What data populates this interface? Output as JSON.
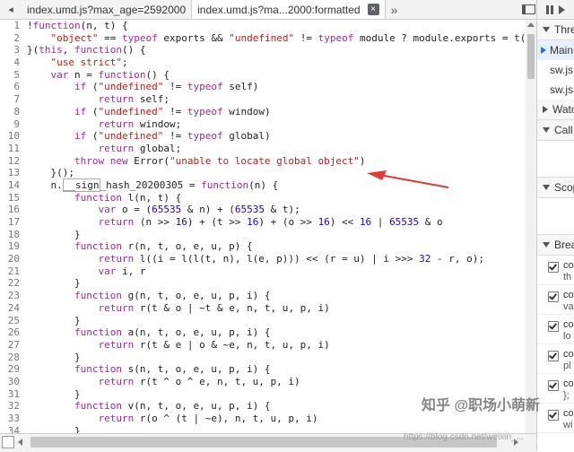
{
  "tabs": {
    "nav_left": "◂",
    "items": [
      {
        "label": "index.umd.js?max_age=2592000",
        "active": false
      },
      {
        "label": "index.umd.js?ma...2000:formatted",
        "active": true
      }
    ],
    "close_glyph": "×",
    "overflow": "»"
  },
  "code_lines": [
    {
      "n": "1",
      "parts": [
        {
          "t": "!"
        },
        {
          "t": "function",
          "c": "kw"
        },
        {
          "t": "(n, t) {"
        }
      ]
    },
    {
      "n": "2",
      "parts": [
        {
          "t": "    "
        },
        {
          "t": "\"object\"",
          "c": "str"
        },
        {
          "t": " == "
        },
        {
          "t": "typeof",
          "c": "kw"
        },
        {
          "t": " exports && "
        },
        {
          "t": "\"undefined\"",
          "c": "str"
        },
        {
          "t": " != "
        },
        {
          "t": "typeof",
          "c": "kw"
        },
        {
          "t": " module ? module.exports = t() :"
        }
      ]
    },
    {
      "n": "3",
      "parts": [
        {
          "t": "}("
        },
        {
          "t": "this",
          "c": "kw"
        },
        {
          "t": ", "
        },
        {
          "t": "function",
          "c": "kw"
        },
        {
          "t": "() {"
        }
      ]
    },
    {
      "n": "4",
      "parts": [
        {
          "t": "    "
        },
        {
          "t": "\"use strict\"",
          "c": "str"
        },
        {
          "t": ";"
        }
      ]
    },
    {
      "n": "5",
      "parts": [
        {
          "t": "    "
        },
        {
          "t": "var",
          "c": "kw"
        },
        {
          "t": " n = "
        },
        {
          "t": "function",
          "c": "kw"
        },
        {
          "t": "() {"
        }
      ]
    },
    {
      "n": "6",
      "parts": [
        {
          "t": "        "
        },
        {
          "t": "if",
          "c": "kw"
        },
        {
          "t": " ("
        },
        {
          "t": "\"undefined\"",
          "c": "str"
        },
        {
          "t": " != "
        },
        {
          "t": "typeof",
          "c": "kw"
        },
        {
          "t": " self)"
        }
      ]
    },
    {
      "n": "7",
      "parts": [
        {
          "t": "            "
        },
        {
          "t": "return",
          "c": "kw"
        },
        {
          "t": " self;"
        }
      ]
    },
    {
      "n": "8",
      "parts": [
        {
          "t": "        "
        },
        {
          "t": "if",
          "c": "kw"
        },
        {
          "t": " ("
        },
        {
          "t": "\"undefined\"",
          "c": "str"
        },
        {
          "t": " != "
        },
        {
          "t": "typeof",
          "c": "kw"
        },
        {
          "t": " window)"
        }
      ]
    },
    {
      "n": "9",
      "parts": [
        {
          "t": "            "
        },
        {
          "t": "return",
          "c": "kw"
        },
        {
          "t": " window;"
        }
      ]
    },
    {
      "n": "10",
      "parts": [
        {
          "t": "        "
        },
        {
          "t": "if",
          "c": "kw"
        },
        {
          "t": " ("
        },
        {
          "t": "\"undefined\"",
          "c": "str"
        },
        {
          "t": " != "
        },
        {
          "t": "typeof",
          "c": "kw"
        },
        {
          "t": " global)"
        }
      ]
    },
    {
      "n": "11",
      "parts": [
        {
          "t": "            "
        },
        {
          "t": "return",
          "c": "kw"
        },
        {
          "t": " global;"
        }
      ]
    },
    {
      "n": "12",
      "parts": [
        {
          "t": "        "
        },
        {
          "t": "throw new",
          "c": "kw"
        },
        {
          "t": " Error("
        },
        {
          "t": "\"unable to locate global object\"",
          "c": "str"
        },
        {
          "t": ")"
        }
      ]
    },
    {
      "n": "13",
      "parts": [
        {
          "t": "    }();"
        }
      ]
    },
    {
      "n": "14",
      "parts": [
        {
          "t": "    n."
        },
        {
          "t": "__sign",
          "c": "hl"
        },
        {
          "t": "_hash_20200305 = "
        },
        {
          "t": "function",
          "c": "kw"
        },
        {
          "t": "(n) {"
        }
      ]
    },
    {
      "n": "15",
      "parts": [
        {
          "t": "        "
        },
        {
          "t": "function",
          "c": "kw"
        },
        {
          "t": " l(n, t) {"
        }
      ]
    },
    {
      "n": "16",
      "parts": [
        {
          "t": "            "
        },
        {
          "t": "var",
          "c": "kw"
        },
        {
          "t": " o = ("
        },
        {
          "t": "65535",
          "c": "num"
        },
        {
          "t": " & n) + ("
        },
        {
          "t": "65535",
          "c": "num"
        },
        {
          "t": " & t);"
        }
      ]
    },
    {
      "n": "17",
      "parts": [
        {
          "t": "            "
        },
        {
          "t": "return",
          "c": "kw"
        },
        {
          "t": " (n >> "
        },
        {
          "t": "16",
          "c": "num"
        },
        {
          "t": ") + (t >> "
        },
        {
          "t": "16",
          "c": "num"
        },
        {
          "t": ") + (o >> "
        },
        {
          "t": "16",
          "c": "num"
        },
        {
          "t": ") << "
        },
        {
          "t": "16",
          "c": "num"
        },
        {
          "t": " | "
        },
        {
          "t": "65535",
          "c": "num"
        },
        {
          "t": " & o"
        }
      ]
    },
    {
      "n": "18",
      "parts": [
        {
          "t": "        }"
        }
      ]
    },
    {
      "n": "19",
      "parts": [
        {
          "t": "        "
        },
        {
          "t": "function",
          "c": "kw"
        },
        {
          "t": " r(n, t, o, e, u, p) {"
        }
      ]
    },
    {
      "n": "20",
      "parts": [
        {
          "t": "            "
        },
        {
          "t": "return",
          "c": "kw"
        },
        {
          "t": " l((i = l(l(t, n), l(e, p))) << (r = u) | i >>> "
        },
        {
          "t": "32",
          "c": "num"
        },
        {
          "t": " - r, o);"
        }
      ]
    },
    {
      "n": "21",
      "parts": [
        {
          "t": "            "
        },
        {
          "t": "var",
          "c": "kw"
        },
        {
          "t": " i, r"
        }
      ]
    },
    {
      "n": "22",
      "parts": [
        {
          "t": "        }"
        }
      ]
    },
    {
      "n": "23",
      "parts": [
        {
          "t": "        "
        },
        {
          "t": "function",
          "c": "kw"
        },
        {
          "t": " g(n, t, o, e, u, p, i) {"
        }
      ]
    },
    {
      "n": "24",
      "parts": [
        {
          "t": "            "
        },
        {
          "t": "return",
          "c": "kw"
        },
        {
          "t": " r(t & o | ~t & e, n, t, u, p, i)"
        }
      ]
    },
    {
      "n": "25",
      "parts": [
        {
          "t": "        }"
        }
      ]
    },
    {
      "n": "26",
      "parts": [
        {
          "t": "        "
        },
        {
          "t": "function",
          "c": "kw"
        },
        {
          "t": " a(n, t, o, e, u, p, i) {"
        }
      ]
    },
    {
      "n": "27",
      "parts": [
        {
          "t": "            "
        },
        {
          "t": "return",
          "c": "kw"
        },
        {
          "t": " r(t & e | o & ~e, n, t, u, p, i)"
        }
      ]
    },
    {
      "n": "28",
      "parts": [
        {
          "t": "        }"
        }
      ]
    },
    {
      "n": "29",
      "parts": [
        {
          "t": "        "
        },
        {
          "t": "function",
          "c": "kw"
        },
        {
          "t": " s(n, t, o, e, u, p, i) {"
        }
      ]
    },
    {
      "n": "30",
      "parts": [
        {
          "t": "            "
        },
        {
          "t": "return",
          "c": "kw"
        },
        {
          "t": " r(t ^ o ^ e, n, t, u, p, i)"
        }
      ]
    },
    {
      "n": "31",
      "parts": [
        {
          "t": "        }"
        }
      ]
    },
    {
      "n": "32",
      "parts": [
        {
          "t": "        "
        },
        {
          "t": "function",
          "c": "kw"
        },
        {
          "t": " v(n, t, o, e, u, p, i) {"
        }
      ]
    },
    {
      "n": "33",
      "parts": [
        {
          "t": "            "
        },
        {
          "t": "return",
          "c": "kw"
        },
        {
          "t": " r(o ^ (t | ~e), n, t, u, p, i)"
        }
      ]
    },
    {
      "n": "34",
      "parts": [
        {
          "t": "        }"
        }
      ]
    }
  ],
  "sidebar": {
    "threads_header": "Threa",
    "threads": [
      {
        "label": "Main",
        "selected": true
      },
      {
        "label": "sw.js",
        "selected": false
      },
      {
        "label": "sw.js",
        "selected": false
      }
    ],
    "watch_header": "Watc",
    "callstack_header": "Call S",
    "scope_header": "Scop",
    "breakpoints_header": "Break",
    "breakpoints": [
      {
        "line1": "co",
        "line2": "th"
      },
      {
        "line1": "co",
        "line2": "va"
      },
      {
        "line1": "co",
        "line2": "lo"
      },
      {
        "line1": "co",
        "line2": "pl"
      },
      {
        "line1": "co",
        "line2": "};"
      },
      {
        "line1": "co",
        "line2": "wi"
      }
    ]
  },
  "watermark": {
    "main": "知乎 @职场小萌新",
    "url": "https://blog.csdn.net/weixin_..."
  },
  "colors": {
    "keyword": "#a0299a",
    "string": "#c41a16",
    "number": "#1c00cf",
    "arrow": "#e53935",
    "selected_thread": "#1a73e8"
  }
}
